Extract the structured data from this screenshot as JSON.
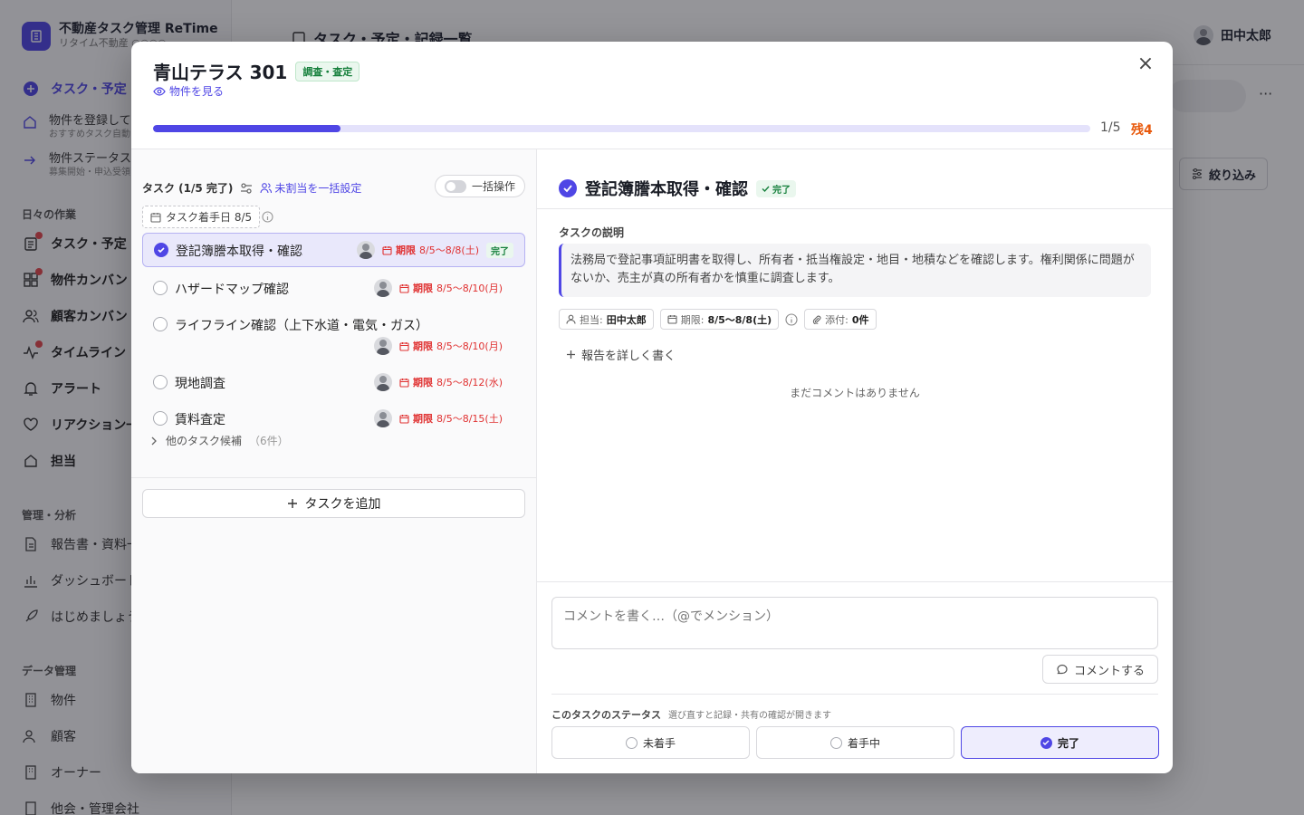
{
  "app": {
    "brand_title": "不動産タスク管理 ReTime",
    "brand_sub": "リタイム不動産 ○○○○",
    "page_title": "タスク・予定・記録一覧",
    "user_name": "田中太郎"
  },
  "sidebar": {
    "primary": "タスク・予定・",
    "promos": [
      {
        "title": "物件を登録して",
        "sub": "おすすめタスク自動"
      },
      {
        "title": "物件ステータスの",
        "sub": "募集開始・申込受領"
      }
    ],
    "daily_section": "日々の作業",
    "daily_items": [
      "タスク・予定・",
      "物件カンバン",
      "顧客カンバン",
      "タイムライン",
      "アラート",
      "リアクション一",
      "担当"
    ],
    "mgmt_section": "管理・分析",
    "mgmt_items": [
      "報告書・資料一",
      "ダッシュボード",
      "はじめましょう"
    ],
    "data_section": "データ管理",
    "data_items": [
      "物件",
      "顧客",
      "オーナー",
      "他会・管理会社"
    ]
  },
  "background": {
    "filter_label": "絞り込み"
  },
  "modal": {
    "property_name": "青山テラス 301",
    "category_chip": "調査・査定",
    "view_property": "物件を見る",
    "progress_fraction": 0.2,
    "progress_count": "1/5",
    "remaining": "残4",
    "left": {
      "header": "タスク (1/5 完了)",
      "assign_link": "未割当を一括設定",
      "bulk_label": "一括操作",
      "start_date": "タスク着手日 8/5",
      "tasks": [
        {
          "name": "登記簿謄本取得・確認",
          "due_label": "期限",
          "due": "8/5〜8/8(土)",
          "status": "完了"
        },
        {
          "name": "ハザードマップ確認",
          "due_label": "期限",
          "due": "8/5〜8/10(月)"
        },
        {
          "name": "ライフライン確認（上下水道・電気・ガス）",
          "due_label": "期限",
          "due": "8/5〜8/10(月)"
        },
        {
          "name": "現地調査",
          "due_label": "期限",
          "due": "8/5〜8/12(水)"
        },
        {
          "name": "賃料査定",
          "due_label": "期限",
          "due": "8/5〜8/15(土)"
        }
      ],
      "others_label": "他のタスク候補",
      "others_count": "（6件）",
      "add_task": "タスクを追加"
    },
    "right": {
      "title": "登記簿謄本取得・確認",
      "status_chip": "完了",
      "desc_label": "タスクの説明",
      "description": "法務局で登記事項証明書を取得し、所有者・抵当権設定・地目・地積などを確認します。権利関係に問題がないか、売主が真の所有者かを慎重に調査します。",
      "assignee_label": "担当:",
      "assignee": "田中太郎",
      "due_label": "期限:",
      "due": "8/5〜8/8(土)",
      "attach_label": "添付:",
      "attach": "0件",
      "report_link": "報告を詳しく書く",
      "no_comments": "まだコメントはありません",
      "comment_placeholder": "コメントを書く…（@でメンション）",
      "comment_button": "コメントする",
      "status_label": "このタスクのステータス",
      "status_hint": "選び直すと記録・共有の確認が開きます",
      "status_options": [
        "未着手",
        "着手中",
        "完了"
      ]
    }
  },
  "colors": {
    "accent": "#4f46e5",
    "danger": "#e03131",
    "success": "#16803c",
    "warn": "#e8590c"
  }
}
